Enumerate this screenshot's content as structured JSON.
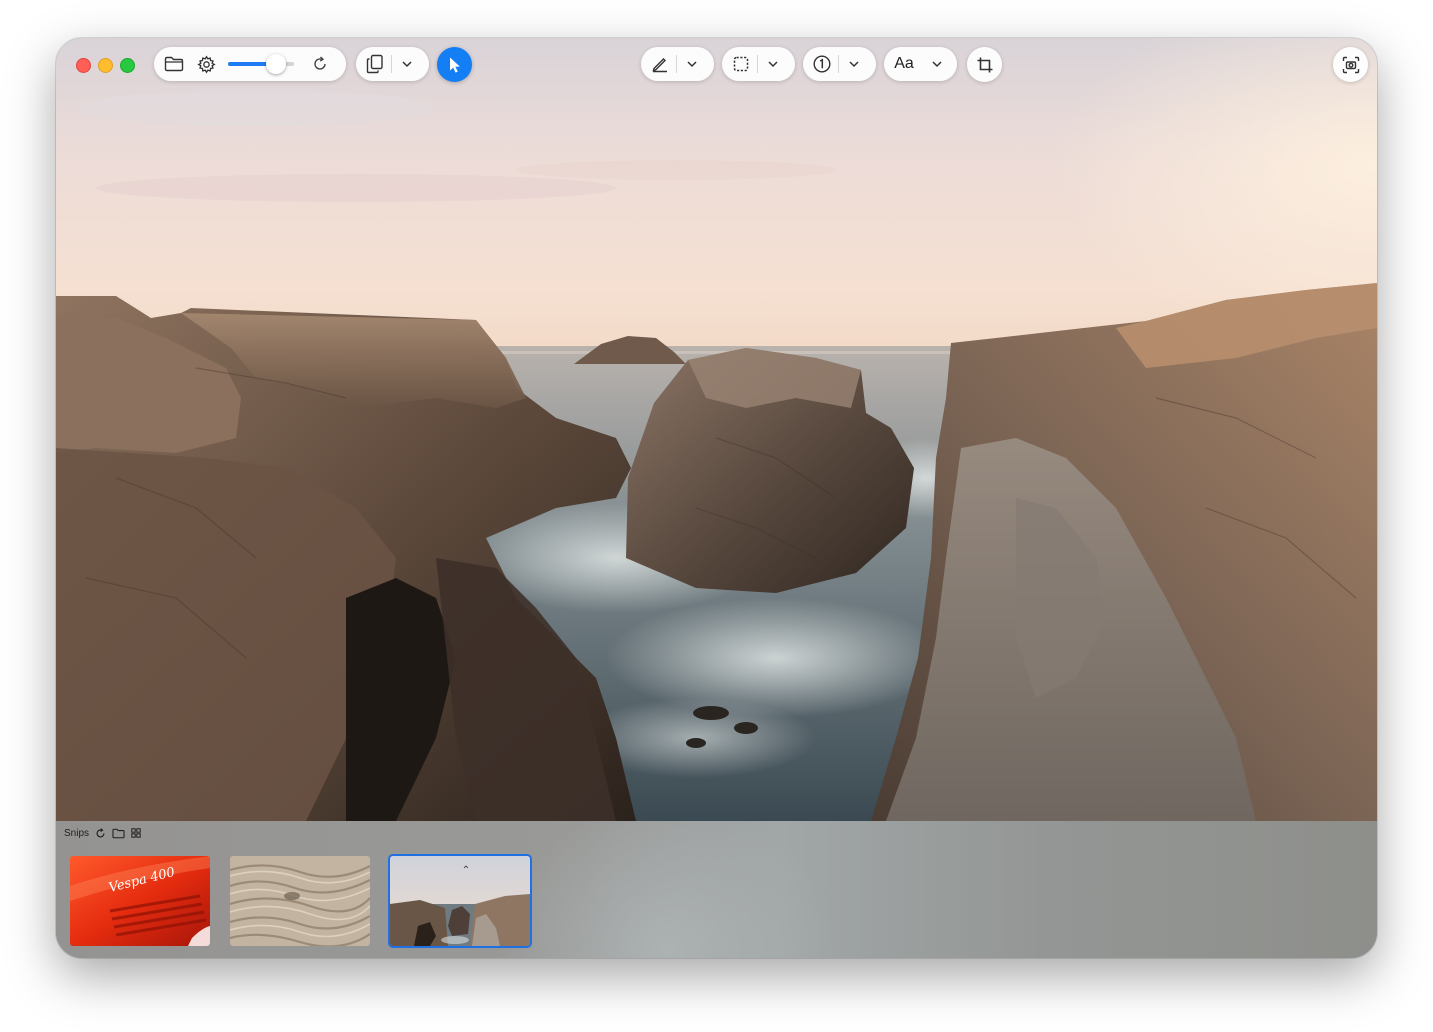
{
  "window": {
    "controls": [
      "close",
      "minimize",
      "zoom"
    ]
  },
  "toolbar": {
    "left_group": {
      "icons": [
        "folder-icon",
        "gear-icon",
        "refresh-icon"
      ],
      "slider_value": 0.72
    },
    "copy_group": {
      "icons": [
        "copy-icon",
        "chevron-down-icon"
      ]
    },
    "select_tool": {
      "icon": "cursor-arrow-icon",
      "active": true
    },
    "annotation_tools": [
      {
        "icon": "pen-icon",
        "has_menu": true
      },
      {
        "icon": "rectangle-select-icon",
        "has_menu": true
      },
      {
        "icon": "number-stamp-icon",
        "has_menu": true
      },
      {
        "icon": "text-tool-icon",
        "label": "Aa",
        "has_menu": true
      },
      {
        "icon": "crop-icon",
        "has_menu": false
      }
    ],
    "capture_button": {
      "icon": "screen-capture-icon"
    }
  },
  "snips": {
    "title": "Snips",
    "header_icons": [
      "refresh-icon",
      "folder-icon",
      "grid-icon"
    ],
    "items": [
      {
        "kind": "red-scooter",
        "badge_text": "Vespa 400",
        "selected": false
      },
      {
        "kind": "sand-dunes",
        "selected": false
      },
      {
        "kind": "coastal-rocks",
        "selected": true
      }
    ]
  },
  "colors": {
    "accent": "#147ef5",
    "selection": "#1f6fe5",
    "close": "#ff5f57",
    "minimize": "#febc2e",
    "zoom": "#28c840"
  }
}
